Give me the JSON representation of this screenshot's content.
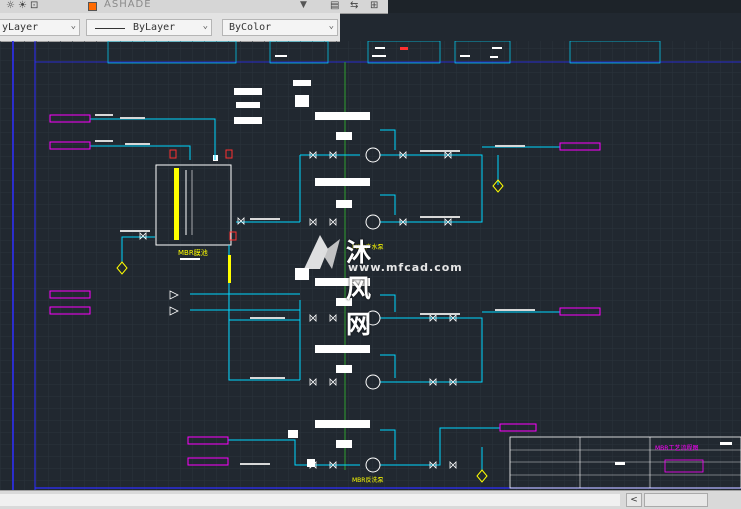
{
  "toolbar": {
    "layer_name": "ASHADE",
    "color_combo": "ByColor",
    "linetype_combo": "ByLayer",
    "layer_combo": "yLayer"
  },
  "drawing": {
    "tank_label": "MBR膜池",
    "title_block_label": "MBR工艺流程图",
    "pump_label_1": "MBR产水泵",
    "pump_label_2": "MBR反洗泵"
  },
  "watermark": {
    "cn_text": "沐风网",
    "url": "www.mfcad.com"
  },
  "colors": {
    "background": "#212830",
    "pipe_cyan": "#00d7ff",
    "line_magenta": "#ff00ff",
    "line_blue": "#2d2dff",
    "yellow": "#ffff00"
  }
}
